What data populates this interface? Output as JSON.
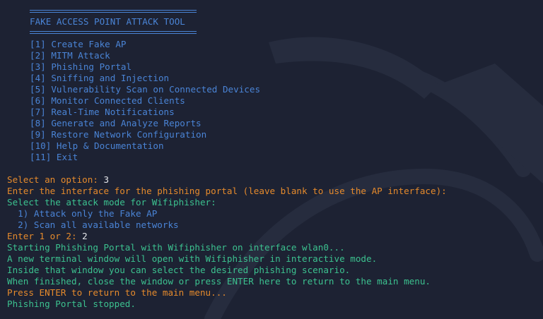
{
  "banner": {
    "title": "FAKE ACCESS POINT ATTACK TOOL"
  },
  "menu": {
    "items": [
      "[1] Create Fake AP",
      "[2] MITM Attack",
      "[3] Phishing Portal",
      "[4] Sniffing and Injection",
      "[5] Vulnerability Scan on Connected Devices",
      "[6] Monitor Connected Clients",
      "[7] Real-Time Notifications",
      "[8] Generate and Analyze Reports",
      "[9] Restore Network Configuration",
      "[10] Help & Documentation",
      "[11] Exit"
    ]
  },
  "session": {
    "select_prompt": "Select an option: ",
    "select_value": "3",
    "interface_prompt": "Enter the interface for the phishing portal (leave blank to use the AP interface):",
    "mode_prompt": "Select the attack mode for Wifiphisher:",
    "mode_option_1": "  1) Attack only the Fake AP",
    "mode_option_2": "  2) Scan all available networks",
    "choice_prompt": "Enter 1 or 2: ",
    "choice_value": "2",
    "starting_msg": "Starting Phishing Portal with Wifiphisher on interface wlan0...",
    "window_msg": "A new terminal window will open with Wifiphisher in interactive mode.",
    "inside_msg": "Inside that window you can select the desired phishing scenario.",
    "finished_msg": "When finished, close the window or press ENTER here to return to the main menu.",
    "return_prompt": "Press ENTER to return to the main menu...",
    "stopped_msg": "Phishing Portal stopped."
  },
  "colors": {
    "background": "#1d2233",
    "menu_blue": "#4a84d6",
    "prompt_orange": "#e58a2c",
    "info_green": "#3cc18f",
    "input_white": "#e4e6ea"
  }
}
